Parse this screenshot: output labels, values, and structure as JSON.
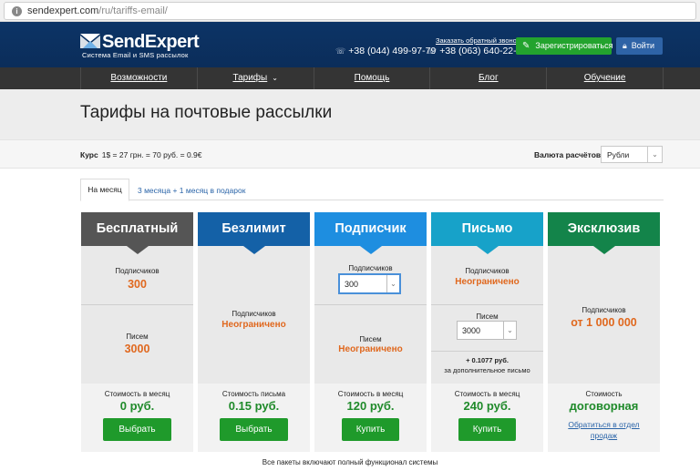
{
  "browser": {
    "url_host": "sendexpert.com",
    "url_path": "/ru/tariffs-email/",
    "info_icon": "info-circle-icon"
  },
  "header": {
    "logo_text": "SendExpert",
    "logo_sub": "Система Email и SMS рассылок",
    "phone1": "+38 (044) 499-97-79",
    "phone2": "+38 (063) 640-22-13",
    "callback": "Заказать обратный звонок",
    "register_label": "Зарегистрироваться",
    "login_label": "Войти",
    "colors": {
      "header_bg": "#0c3466",
      "register_bg": "#23a32e",
      "login_bg": "#2e63a6"
    }
  },
  "nav": {
    "items": [
      {
        "label": "Возможности"
      },
      {
        "label": "Тарифы"
      },
      {
        "label": "Помощь"
      },
      {
        "label": "Блог"
      },
      {
        "label": "Обучение"
      }
    ]
  },
  "page": {
    "title": "Тарифы на почтовые рассылки"
  },
  "rate": {
    "label": "Курс",
    "text": "1$ = 27 грн. = 70 руб. = 0.9€",
    "currency_label": "Валюта расчётов",
    "currency_value": "Рубли"
  },
  "tabs": {
    "active": "На месяц",
    "other": "3 месяца + 1 месяц в подарок"
  },
  "plans": [
    {
      "name": "Бесплатный",
      "color": "#555555",
      "l1": "Подписчиков",
      "v1": "300",
      "l2": "Писем",
      "v2": "3000",
      "price_label": "Стоимость в месяц",
      "price": "0 руб.",
      "button": "Выбрать"
    },
    {
      "name": "Безлимит",
      "color": "#1461a7",
      "l1": "Подписчиков",
      "v1": "Неограничено",
      "price_label": "Стоимость письма",
      "price": "0.15 руб.",
      "button": "Выбрать"
    },
    {
      "name": "Подписчик",
      "color": "#1e8ee0",
      "l1": "Подписчиков",
      "v1": "300",
      "l2": "Писем",
      "v2": "Неограничено",
      "price_label": "Стоимость в месяц",
      "price": "120 руб.",
      "button": "Купить"
    },
    {
      "name": "Письмо",
      "color": "#17a2c9",
      "l1": "Подписчиков",
      "v1": "Неограничено",
      "l2": "Писем",
      "v2": "3000",
      "extra_value": "+ 0.1077 руб.",
      "extra_text": "за дополнительное письмо",
      "price_label": "Стоимость в месяц",
      "price": "240 руб.",
      "button": "Купить"
    },
    {
      "name": "Эксклюзив",
      "color": "#13844a",
      "l1": "Подписчиков",
      "v1": "от 1 000 000",
      "price_label": "Стоимость",
      "price": "договорная",
      "contact": "Обратиться в отдел продаж"
    }
  ],
  "footnote": "Все пакеты включают полный функционал системы"
}
